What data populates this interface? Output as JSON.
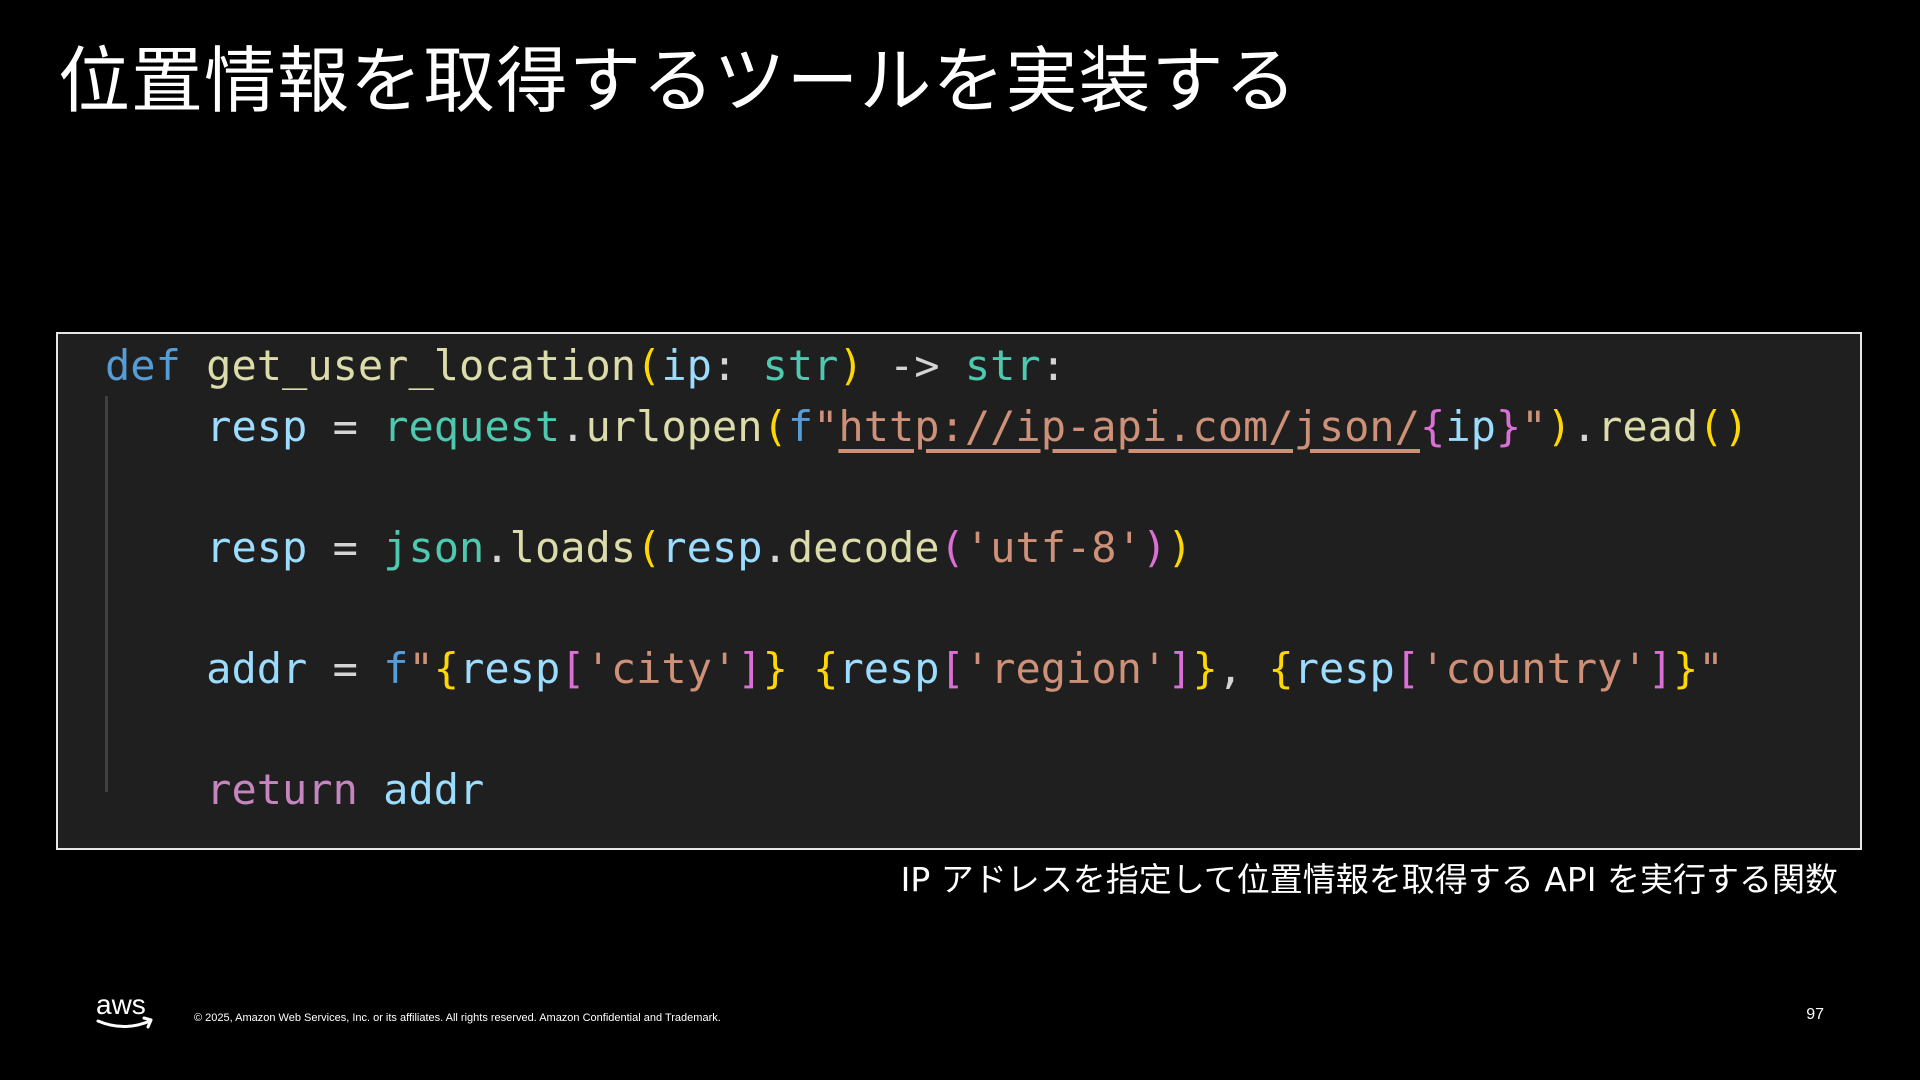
{
  "slide": {
    "title": "位置情報を取得するツールを実装する",
    "caption": "IP アドレスを指定して位置情報を取得する API を実行する関数",
    "copyright": "© 2025, Amazon Web Services, Inc. or its affiliates. All rights reserved. Amazon Confidential and Trademark.",
    "page_number": "97",
    "logo_text": "aws"
  },
  "code": {
    "language": "python",
    "lines": [
      "def get_user_location(ip: str) -> str:",
      "    resp = request.urlopen(f\"http://ip-api.com/json/{ip}\").read()",
      "",
      "    resp = json.loads(resp.decode('utf-8'))",
      "",
      "    addr = f\"{resp['city']} {resp['region']}, {resp['country']}\"",
      "",
      "    return addr"
    ]
  },
  "colors": {
    "background": "#000000",
    "code_background": "#1f1f1f",
    "code_border": "#e6e6e6",
    "keyword": "#569cd6",
    "function": "#dcdcaa",
    "variable": "#9cdcfe",
    "class": "#4ec9b0",
    "control": "#c586c0",
    "string": "#ce9178",
    "bracket": "#ffd700"
  },
  "icons": {
    "logo": "aws-logo-icon"
  }
}
